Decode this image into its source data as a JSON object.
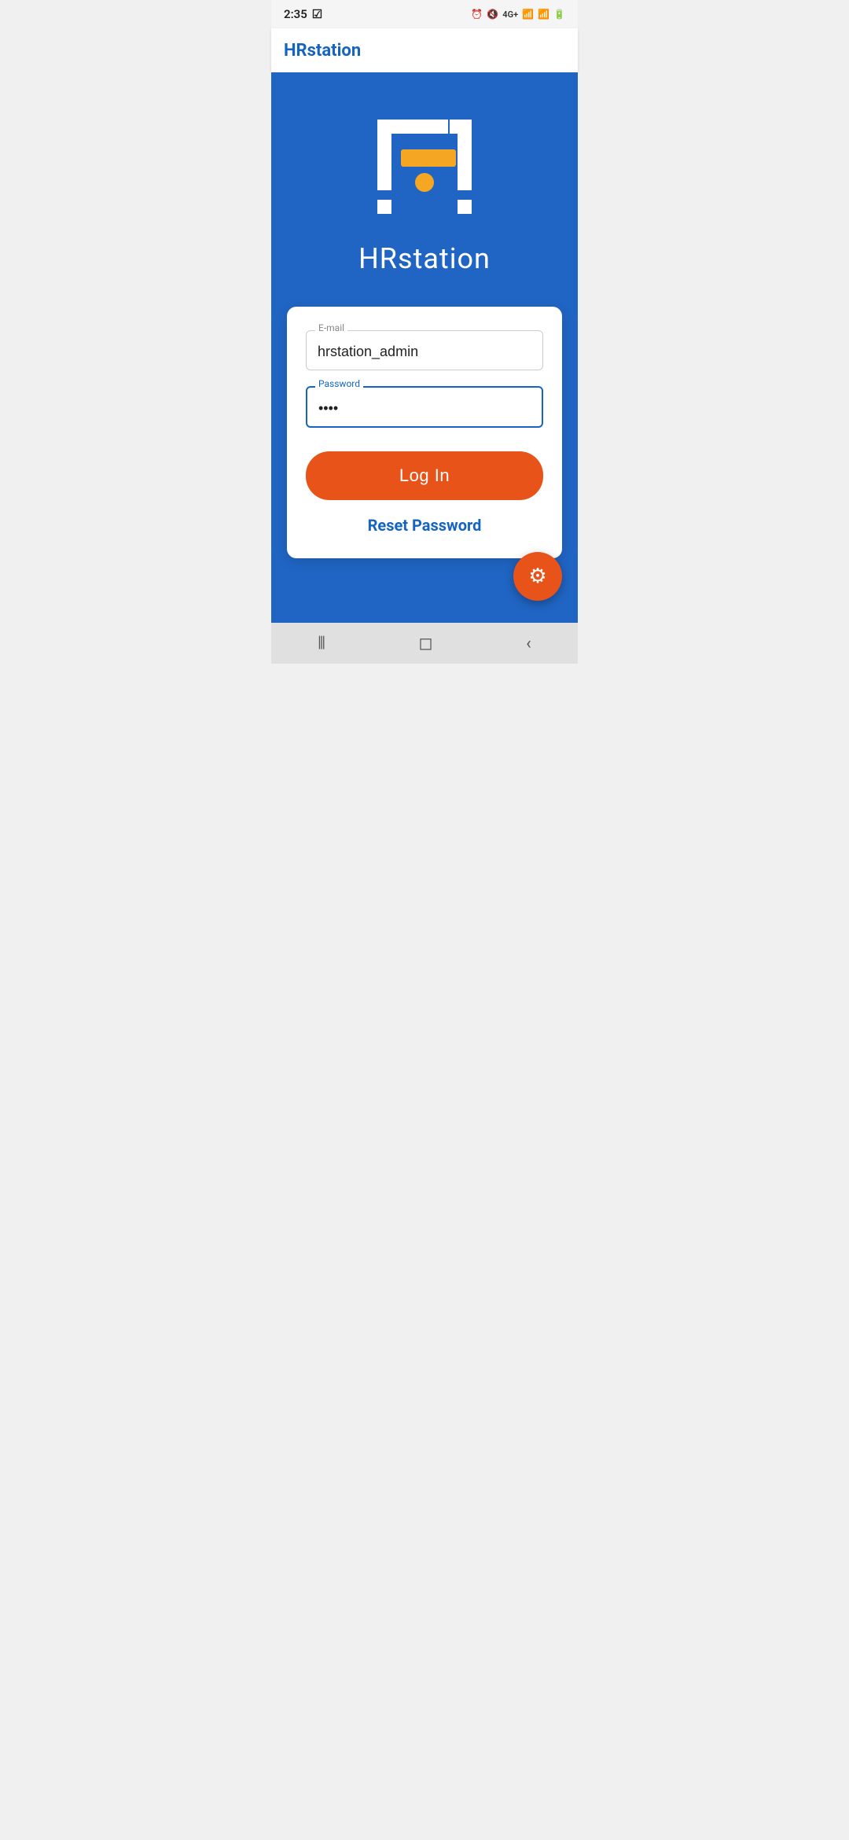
{
  "statusBar": {
    "time": "2:35",
    "icons": [
      "alarm",
      "mute",
      "4g+",
      "signal1",
      "signal2",
      "battery"
    ]
  },
  "appBar": {
    "title": "HRstation"
  },
  "logo": {
    "text": "HRstation",
    "accentColor": "#F5A623",
    "bgColor": "#2065C4"
  },
  "form": {
    "emailLabel": "E-mail",
    "emailValue": "hrstation_admin",
    "emailPlaceholder": "hrstation_admin",
    "passwordLabel": "Password",
    "passwordValue": "••••",
    "loginButton": "Log In",
    "resetLink": "Reset Password"
  },
  "fab": {
    "icon": "⚙",
    "color": "#E8531A"
  },
  "bottomNav": {
    "icons": [
      "|||",
      "○",
      "<"
    ]
  }
}
